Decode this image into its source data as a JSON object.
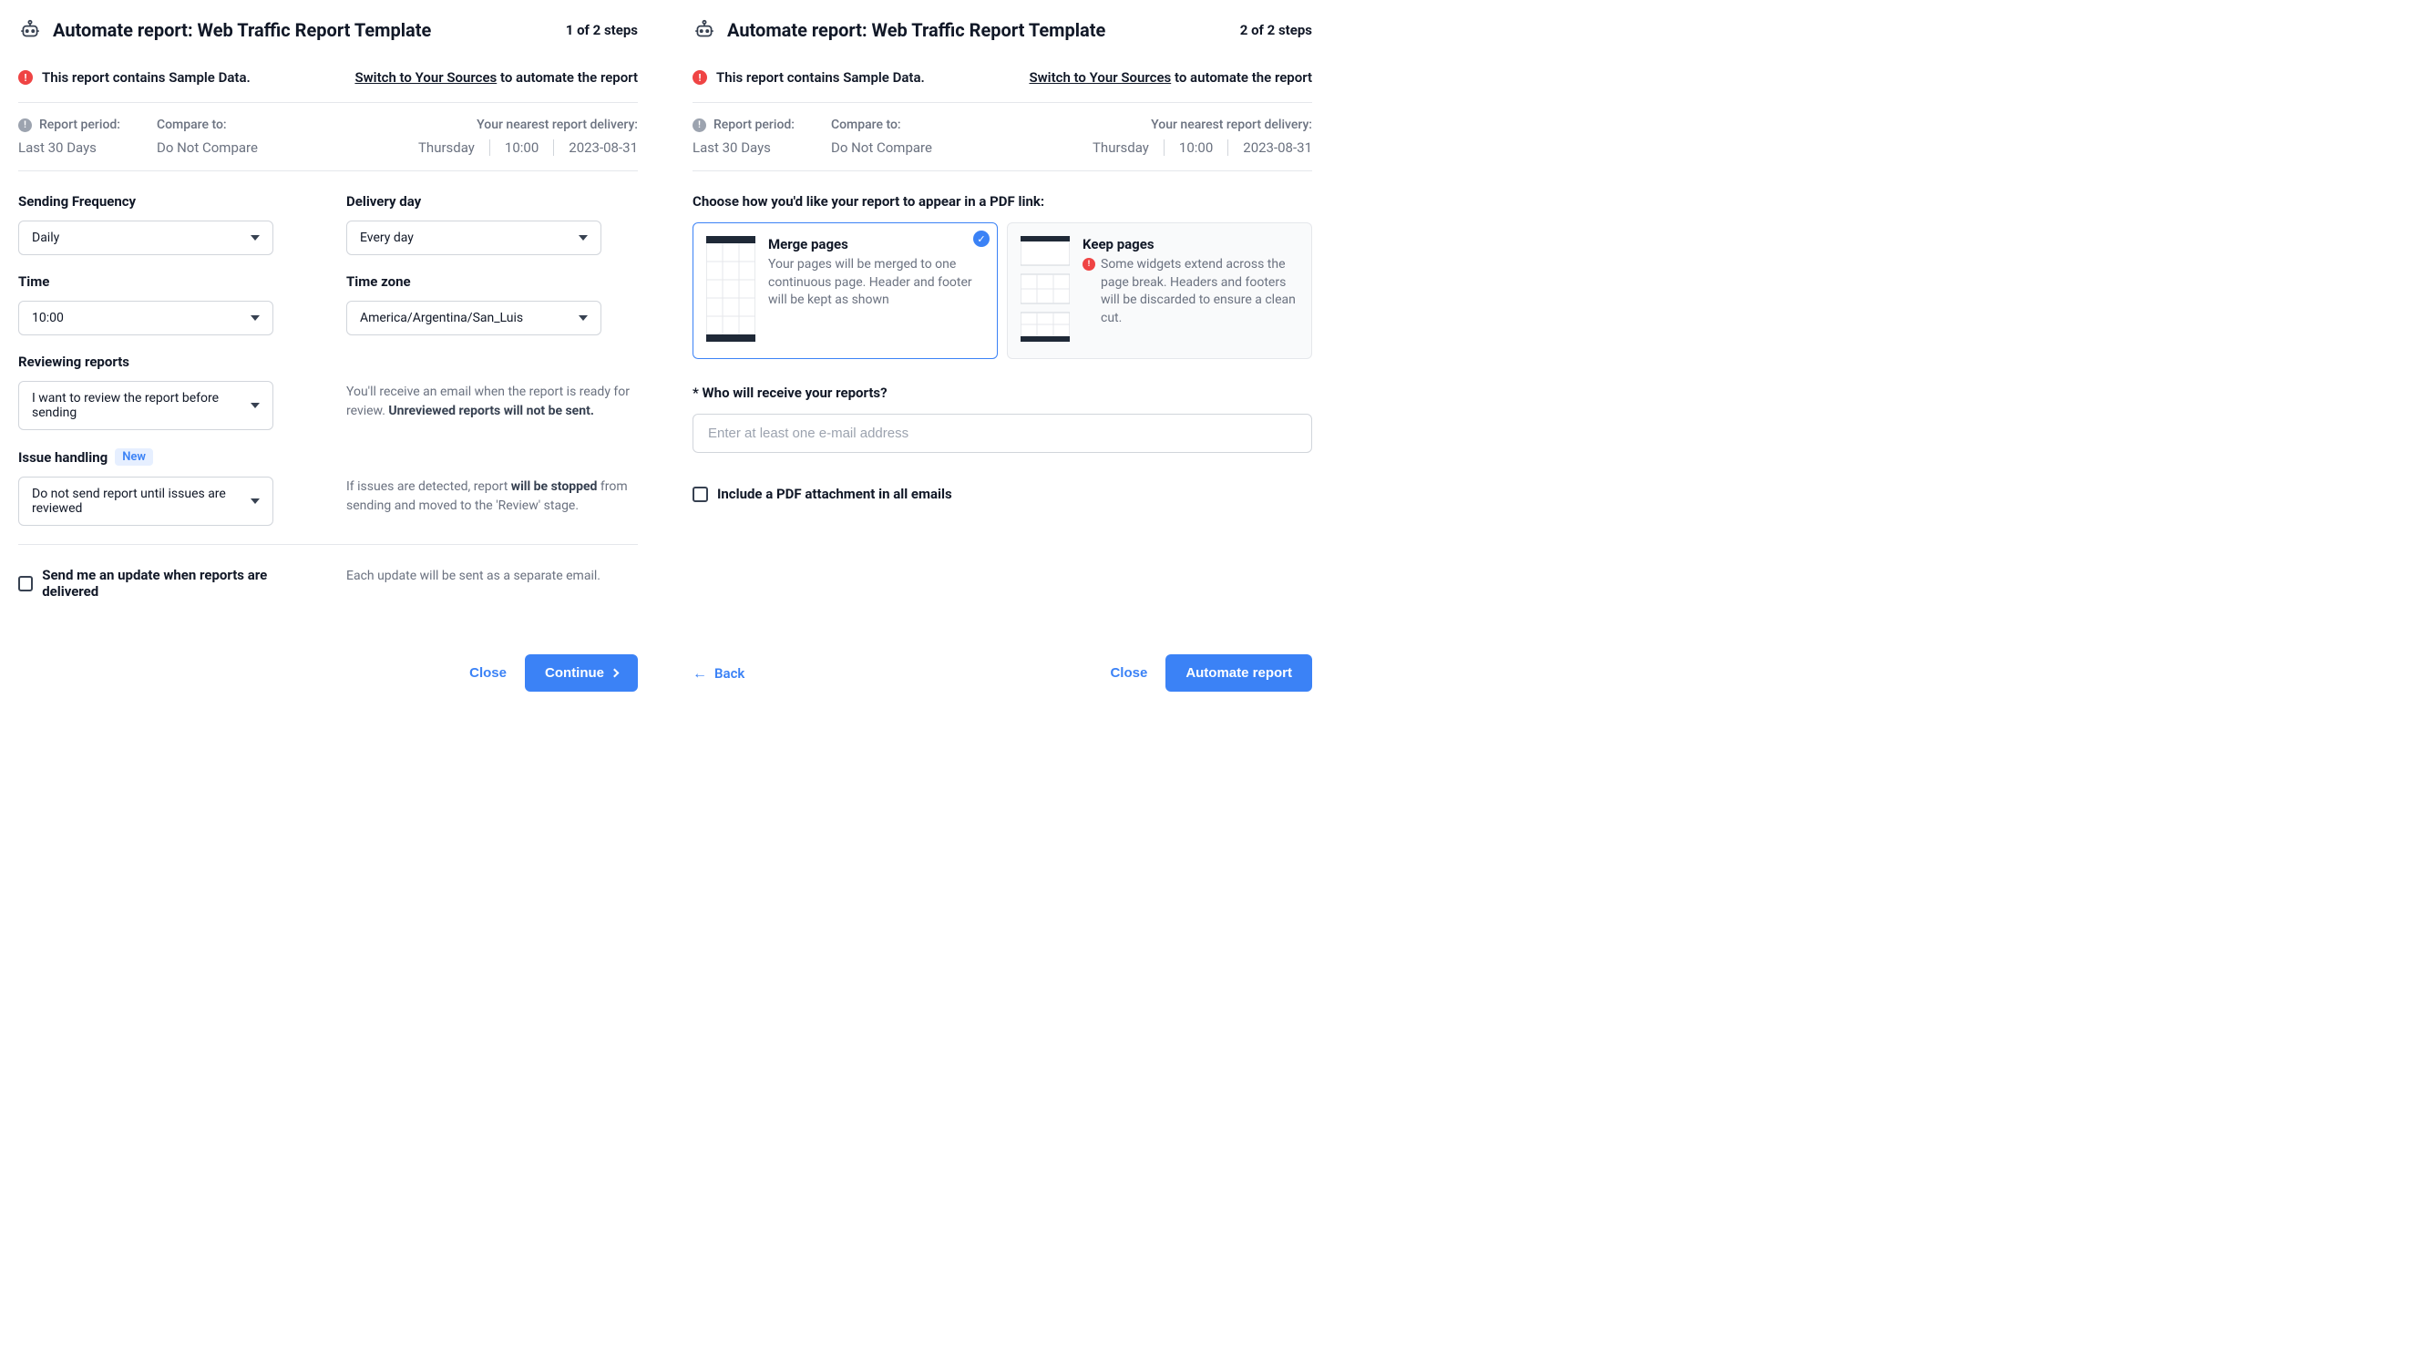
{
  "step1": {
    "title": "Automate report: Web Traffic Report Template",
    "step_text": "1 of 2 steps",
    "alert_text": "This report contains Sample Data.",
    "alert_link": "Switch to Your Sources",
    "alert_suffix": " to automate the report",
    "meta": {
      "period_label": "Report period:",
      "period_value": "Last 30 Days",
      "compare_label": "Compare to:",
      "compare_value": "Do Not Compare",
      "delivery_label": "Your nearest report delivery:",
      "delivery_day": "Thursday",
      "delivery_time": "10:00",
      "delivery_date": "2023-08-31"
    },
    "freq_label": "Sending Frequency",
    "freq_value": "Daily",
    "delivery_day_label": "Delivery day",
    "delivery_day_value": "Every day",
    "time_label": "Time",
    "time_value": "10:00",
    "tz_label": "Time zone",
    "tz_value": "America/Argentina/San_Luis",
    "review_label": "Reviewing reports",
    "review_value": "I want to review the report before sending",
    "review_help_1": "You'll receive an email when the report is ready for review. ",
    "review_help_2": "Unreviewed reports will not be sent.",
    "issue_label": "Issue handling",
    "issue_badge": "New",
    "issue_value": "Do not send report until issues are reviewed",
    "issue_help_1": "If issues are detected, report ",
    "issue_help_2": "will be stopped",
    "issue_help_3": " from sending and moved to the 'Review' stage.",
    "update_checkbox": "Send me an update when reports are delivered",
    "update_help": "Each update will be sent as a separate email.",
    "close_btn": "Close",
    "continue_btn": "Continue"
  },
  "step2": {
    "title": "Automate report: Web Traffic Report Template",
    "step_text": "2 of 2 steps",
    "alert_text": "This report contains Sample Data.",
    "alert_link": "Switch to Your Sources",
    "alert_suffix": " to automate the report",
    "meta": {
      "period_label": "Report period:",
      "period_value": "Last 30 Days",
      "compare_label": "Compare to:",
      "compare_value": "Do Not Compare",
      "delivery_label": "Your nearest report delivery:",
      "delivery_time": "10:00",
      "delivery_day": "Thursday",
      "delivery_date": "2023-08-31"
    },
    "pdf_heading": "Choose how you'd like your report to appear in a PDF link:",
    "merge_title": "Merge pages",
    "merge_desc": "Your pages will be merged to one continuous page. Header and footer will be kept as shown",
    "keep_title": "Keep pages",
    "keep_desc": "Some widgets extend across the page break. Headers and footers will be discarded to ensure a clean cut.",
    "recipients_label": "* Who will receive your reports?",
    "recipients_placeholder": "Enter at least one e-mail address",
    "pdf_checkbox": "Include a PDF attachment in all emails",
    "back_btn": "Back",
    "close_btn": "Close",
    "automate_btn": "Automate report"
  }
}
